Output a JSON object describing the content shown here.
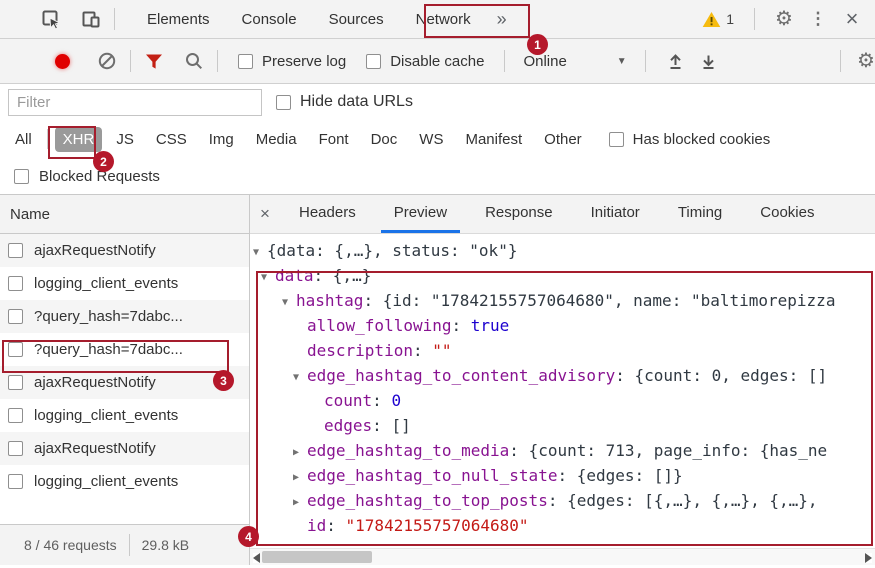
{
  "main_tabs": {
    "items": [
      "Elements",
      "Console",
      "Sources",
      "Network"
    ],
    "overflow": "»"
  },
  "warning": {
    "count": "1"
  },
  "toolbar": {
    "preserve_log": "Preserve log",
    "disable_cache": "Disable cache",
    "throttling": "Online",
    "caret": "▼"
  },
  "filter_bar": {
    "placeholder": "Filter",
    "hide_data_urls": "Hide data URLs"
  },
  "type_filters": {
    "items": [
      "All",
      "XHR",
      "JS",
      "CSS",
      "Img",
      "Media",
      "Font",
      "Doc",
      "WS",
      "Manifest",
      "Other"
    ],
    "selected": "XHR",
    "has_blocked_cookies": "Has blocked cookies"
  },
  "blocked_requests_label": "Blocked Requests",
  "requests": {
    "header": "Name",
    "rows": [
      "ajaxRequestNotify",
      "logging_client_events",
      "?query_hash=7dabc...",
      "?query_hash=7dabc...",
      "ajaxRequestNotify",
      "logging_client_events",
      "ajaxRequestNotify",
      "logging_client_events"
    ],
    "summary": "8 / 46 requests",
    "transferred": "29.8 kB"
  },
  "detail_panel": {
    "close": "×",
    "tabs": [
      "Headers",
      "Preview",
      "Response",
      "Initiator",
      "Timing",
      "Cookies"
    ],
    "active_tab": "Preview"
  },
  "preview": {
    "lines": [
      {
        "m": "▼",
        "plain": "{data: {,…}, status: \"ok\"}"
      },
      {
        "m": "▼",
        "key": "data",
        "rest": ": {,…}"
      },
      {
        "m": "▼",
        "key": "hashtag",
        "rest": ": {id: \"17842155757064680\", name: \"baltimorepizza"
      },
      {
        "m": "",
        "key": "allow_following",
        "sep": ": ",
        "num": "true"
      },
      {
        "m": "",
        "key": "description",
        "sep": ": ",
        "str": "\"\""
      },
      {
        "m": "▼",
        "key": "edge_hashtag_to_content_advisory",
        "rest": ": {count: 0, edges: []"
      },
      {
        "m": "",
        "key": "count",
        "sep": ": ",
        "num": "0"
      },
      {
        "m": "",
        "key": "edges",
        "rest": ": []"
      },
      {
        "m": "▶",
        "key": "edge_hashtag_to_media",
        "rest": ": {count: 713, page_info: {has_ne"
      },
      {
        "m": "▶",
        "key": "edge_hashtag_to_null_state",
        "rest": ": {edges: []}"
      },
      {
        "m": "▶",
        "key": "edge_hashtag_to_top_posts",
        "rest": ": {edges: [{,…}, {,…}, {,…},"
      },
      {
        "m": "",
        "key": "id",
        "sep": ": ",
        "str": "\"17842155757064680\""
      }
    ]
  },
  "annotations": {
    "badges": [
      "1",
      "2",
      "3",
      "4"
    ]
  },
  "colors": {
    "annotation_red": "#a51d2d",
    "badge_red": "#b5182b",
    "active_tab_underline": "#1a73e8",
    "json_key": "#881391",
    "json_number": "#1c00cf",
    "json_string": "#c41a16",
    "selected_pill_bg": "#9a9a9a",
    "record_red": "#e00000",
    "filter_funnel_red": "#c32014",
    "warning_yellow": "#f6bb0f"
  }
}
